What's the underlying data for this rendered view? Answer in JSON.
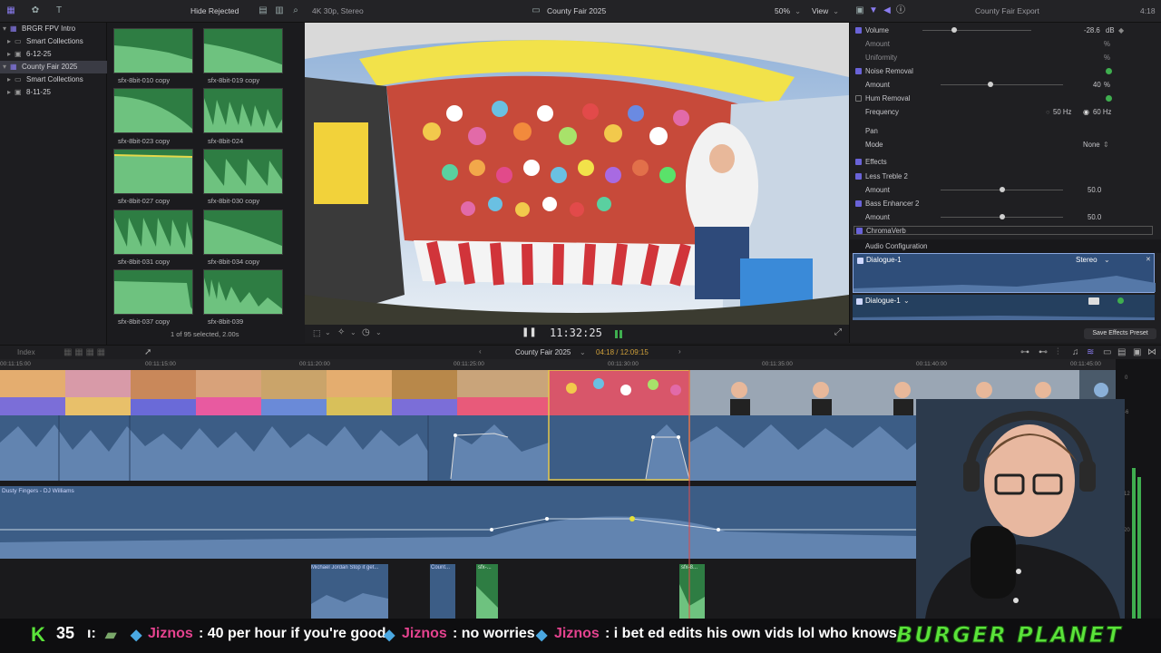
{
  "topbar": {
    "hide_rejected": "Hide Rejected",
    "format": "4K 30p, Stereo",
    "project_title": "County Fair 2025",
    "zoom": "50%",
    "view": "View",
    "inspector_title": "County Fair Export",
    "duration": "4:18"
  },
  "library": {
    "items": [
      {
        "label": "BRGR FPV Intro",
        "level": 0
      },
      {
        "label": "Smart Collections",
        "level": 1
      },
      {
        "label": "6-12-25",
        "level": 1
      },
      {
        "label": "County Fair 2025",
        "level": 0,
        "selected": true
      },
      {
        "label": "Smart Collections",
        "level": 1
      },
      {
        "label": "8-11-25",
        "level": 1
      }
    ]
  },
  "browser": {
    "clips": [
      "sfx-8bit-010 copy",
      "sfx-8bit-019 copy",
      "sfx-8bit-023 copy",
      "sfx-8bit-024",
      "sfx-8bit-027 copy",
      "sfx-8bit-030 copy",
      "sfx-8bit-031 copy",
      "sfx-8bit-034 copy",
      "sfx-8bit-037 copy",
      "sfx-8bit-039"
    ],
    "selection_status": "1 of 95 selected, 2.00s"
  },
  "viewer": {
    "timecode": "11:32:25"
  },
  "inspector": {
    "volume_label": "Volume",
    "volume_value": "-28.6",
    "volume_unit": "dB",
    "amount1_label": "Amount",
    "amount1_unit": "%",
    "uniformity_label": "Uniformity",
    "uniformity_unit": "%",
    "noise_removal": "Noise Removal",
    "amount2_label": "Amount",
    "amount2_value": "40",
    "amount2_unit": "%",
    "hum_removal": "Hum Removal",
    "frequency_label": "Frequency",
    "freq50": "50 Hz",
    "freq60": "60 Hz",
    "pan": "Pan",
    "mode_label": "Mode",
    "mode_value": "None",
    "effects": "Effects",
    "less_treble": "Less Treble 2",
    "amount3_label": "Amount",
    "amount3_value": "50.0",
    "bass_enhancer": "Bass Enhancer 2",
    "amount4_label": "Amount",
    "amount4_value": "50.0",
    "chromaverb": "ChromaVerb",
    "audio_config": "Audio Configuration",
    "dialogue1": "Dialogue-1",
    "stereo": "Stereo",
    "dialogue2": "Dialogue-1",
    "save_preset": "Save Effects Preset"
  },
  "timeline": {
    "index": "Index",
    "project": "County Fair 2025",
    "position": "04:18 / 12:09:15",
    "ruler": [
      "00:11:15:00",
      "00:11:20:00",
      "00:11:25:00",
      "00:11:30:00",
      "00:11:35:00",
      "00:11:40:00",
      "00:11:45:00"
    ],
    "music_clip": "Dusty Fingers - DJ Williams",
    "clip_mj": "Michael Jordan Stop it get...",
    "clip_count": "Count...",
    "clip_sfx1": "sfx-...",
    "clip_sfx2": "sfx-8...",
    "meter_labels": [
      "0",
      "-6",
      "-12",
      "-20"
    ]
  },
  "ticker": {
    "count": "35",
    "user1": "Jiznos",
    "msg1": ": 40 per hour if you're good",
    "user2": "Jiznos",
    "msg2": ": no worries",
    "user3": "Jiznos",
    "msg3": ": i bet ed edits his own vids lol who knows",
    "brand": "BURGER PLANET"
  },
  "colors": {
    "accent": "#6a63d8",
    "clip_green": "#2e7d43",
    "audio_blue": "#3c5d86",
    "selection_yellow": "#e5c84a",
    "chat_user": "#e5438f",
    "brand_green": "#5be33a"
  }
}
